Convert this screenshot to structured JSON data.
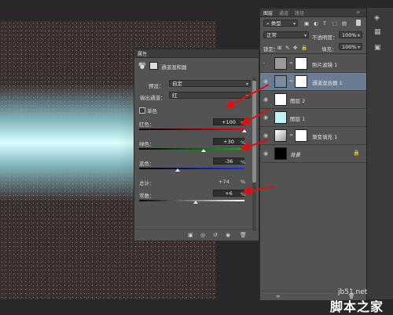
{
  "properties_panel": {
    "title": "属性",
    "adjustment_name": "通道混和器",
    "preset_label": "预设：",
    "preset_value": "自定",
    "output_channel_label": "输出通道：",
    "output_channel_value": "红",
    "monochrome_label": "单色",
    "red_label": "红色：",
    "red_value": "+100",
    "green_label": "绿色：",
    "green_value": "+30",
    "blue_label": "蓝色：",
    "blue_value": "-36",
    "total_label": "总计：",
    "total_value": "+74",
    "constant_label": "常数：",
    "constant_value": "+6",
    "percent": "%"
  },
  "layers_panel": {
    "tabs": [
      "图层",
      "通道",
      "路径"
    ],
    "filter_value": "类型",
    "blend_mode": "正常",
    "opacity_label": "不透明度：",
    "opacity_value": "100%",
    "lock_label": "锁定：",
    "fill_label": "填充：",
    "fill_value": "100%",
    "layers": [
      {
        "name": "照片滤镜 1"
      },
      {
        "name": "通道混合器 1"
      },
      {
        "name": "图层 2"
      },
      {
        "name": "图层 1"
      },
      {
        "name": "渐变填充 1"
      },
      {
        "name": "背景"
      }
    ]
  },
  "watermark": {
    "site": "jb51.net",
    "name": "脚本之家"
  }
}
